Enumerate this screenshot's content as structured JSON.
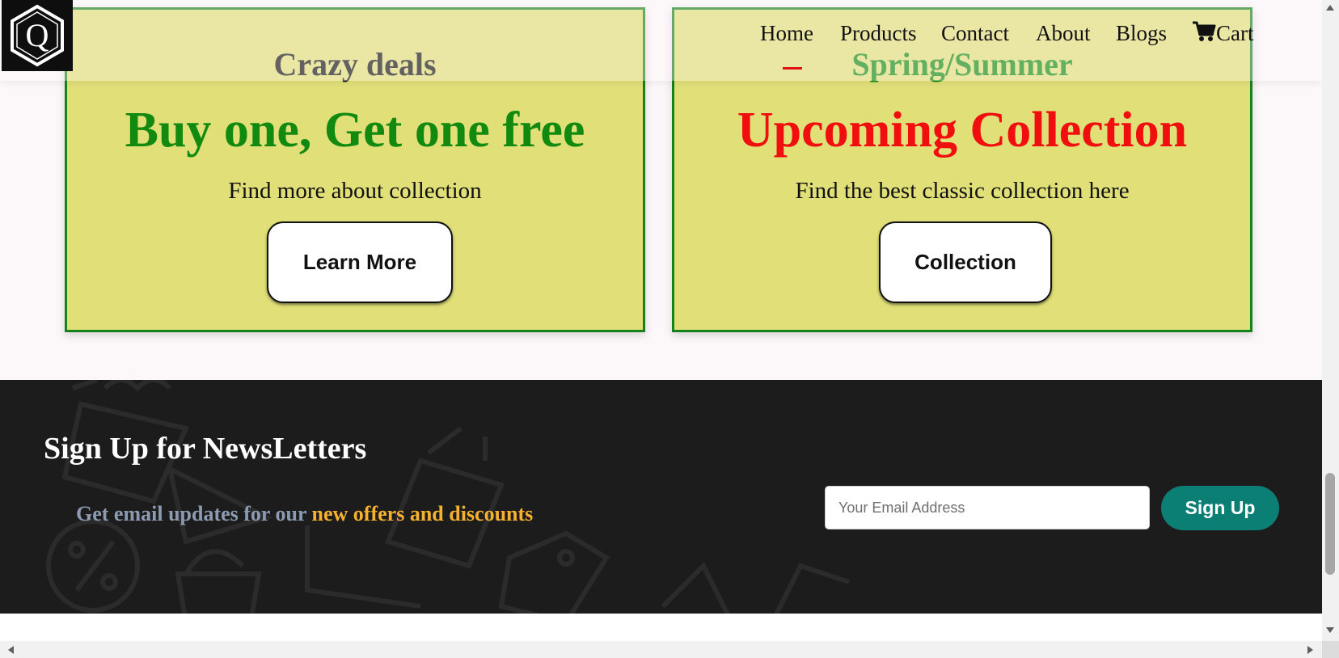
{
  "header": {
    "logo_alt": "Q",
    "nav": [
      {
        "label": "Home"
      },
      {
        "label": "Products"
      },
      {
        "label": "Contact"
      },
      {
        "label": "About"
      },
      {
        "label": "Blogs"
      },
      {
        "label": "Cart",
        "icon": "cart-icon"
      }
    ]
  },
  "banners": {
    "left": {
      "kicker": "Crazy deals",
      "title": "Buy one, Get one free",
      "text": "Find more about collection",
      "button": "Learn More"
    },
    "right": {
      "kicker": "Spring/Summer",
      "title": "Upcoming Collection",
      "text": "Find the best classic collection here",
      "button": "Collection"
    }
  },
  "newsletter": {
    "title": "Sign Up for NewsLetters",
    "sub_prefix": "Get email updates for our ",
    "sub_highlight": "new offers and discounts",
    "email_placeholder": "Your Email Address",
    "button": "Sign Up"
  },
  "colors": {
    "banner_bg": "#e0df78",
    "banner_border": "#15821c",
    "green_text": "#128a10",
    "red_text": "#f10e0e",
    "newsletter_bg": "#1c1c1c",
    "highlight": "#f6b22e",
    "signup_button": "#0c7f74"
  }
}
